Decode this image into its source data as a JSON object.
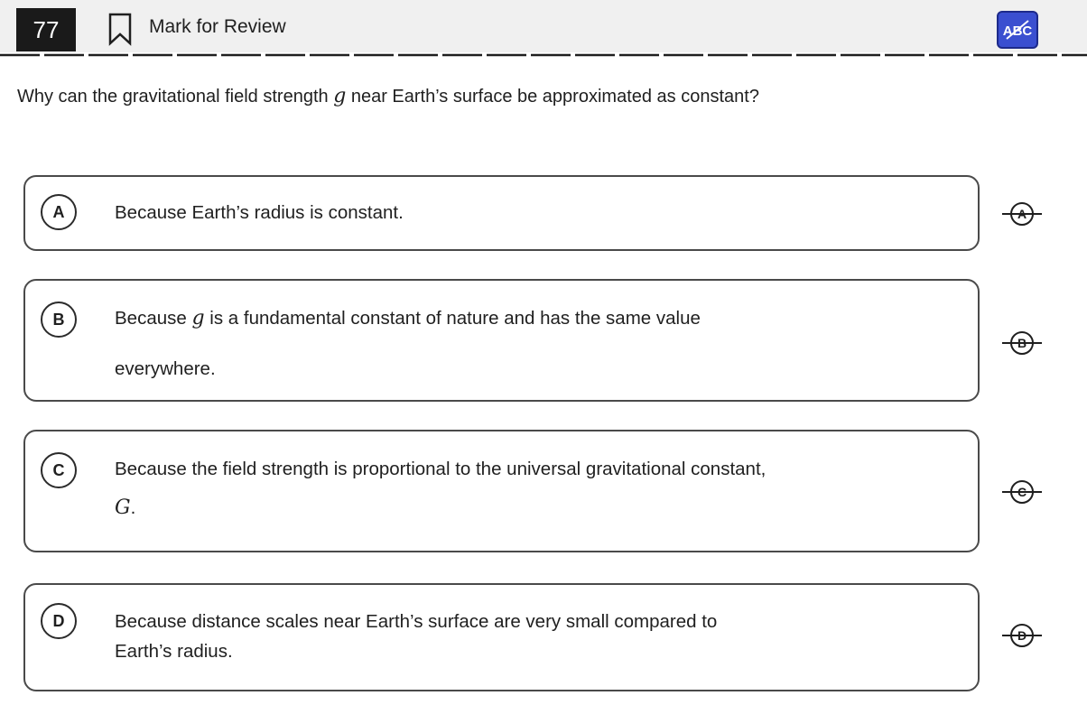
{
  "header": {
    "question_number": "77",
    "mark_for_review_label": "Mark for Review",
    "abc_label": "ABC"
  },
  "question": {
    "text_before": "Why can the gravitational field strength ",
    "variable": "g",
    "text_after": " near Earth’s surface be approximated as constant?"
  },
  "choices": [
    {
      "letter": "A",
      "line1": "Because Earth’s radius is constant."
    },
    {
      "letter": "B",
      "line1_before": "Because ",
      "line1_var": "g",
      "line1_after": " is a fundamental constant of nature and has the same value",
      "line2": "everywhere."
    },
    {
      "letter": "C",
      "line1": "Because the field strength is proportional to the universal gravitational constant,",
      "line2_var": "G",
      "line2_after": "."
    },
    {
      "letter": "D",
      "line1": "Because distance scales near Earth’s surface are very small compared to",
      "line2": "Earth’s radius."
    }
  ],
  "colors": {
    "header_bg": "#f0f0f0",
    "question_number_bg": "#1a1a1a",
    "abc_button_bg": "#3a4fd0",
    "choice_border": "#4a4a4a"
  },
  "icons": {
    "bookmark": "bookmark-outline-icon",
    "abc": "abc-strikethrough-icon"
  }
}
